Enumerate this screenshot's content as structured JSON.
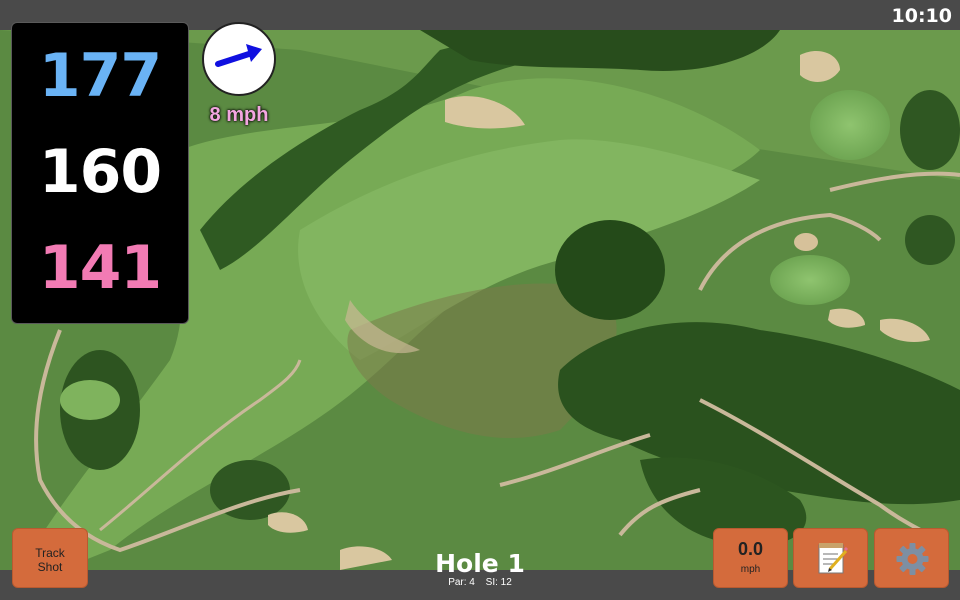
{
  "status_bar": {
    "time": "10:10"
  },
  "distances": {
    "back": "177",
    "middle": "160",
    "front": "141",
    "colors": {
      "back": "#6ab3f5",
      "middle": "#ffffff",
      "front": "#f27bb4"
    }
  },
  "wind": {
    "speed": "8 mph",
    "direction_icon": "arrow-icon",
    "arrow_color": "#1010e0",
    "speed_color": "#f3a6e0"
  },
  "hole": {
    "title": "Hole 1",
    "par_label": "Par: 4",
    "si_label": "SI: 12"
  },
  "buttons": {
    "track_shot": [
      "Track",
      "Shot"
    ],
    "speed_value": "0.0",
    "speed_unit": "mph",
    "notes_icon": "notepad-icon",
    "settings_icon": "gear-icon"
  },
  "colors": {
    "button": "#d46b3c",
    "bar": "#4a4a4a"
  }
}
